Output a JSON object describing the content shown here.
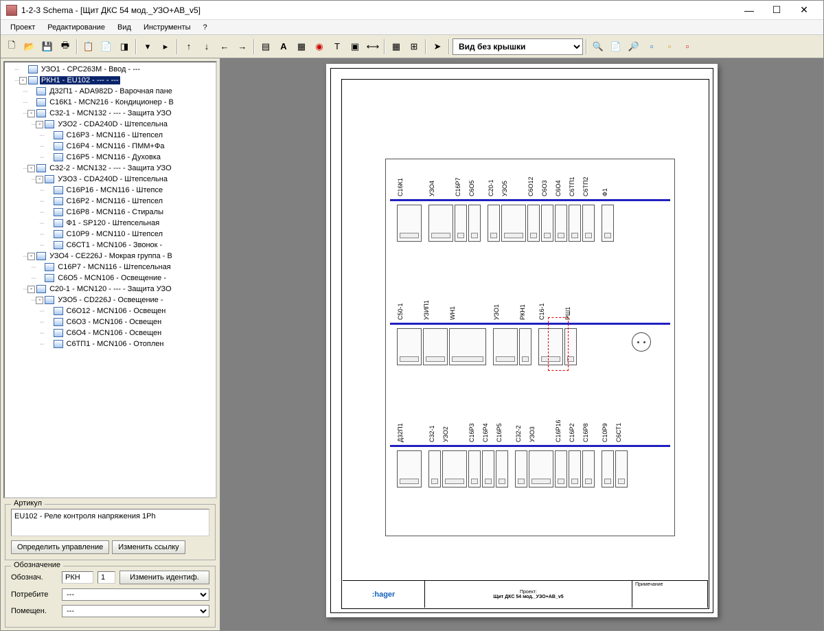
{
  "window": {
    "title": "1-2-3 Schema - [Щит ДКС 54 мод._УЗО+АВ_v5]"
  },
  "menu": {
    "items": [
      "Проект",
      "Редактирование",
      "Вид",
      "Инструменты",
      "?"
    ]
  },
  "toolbar": {
    "view_select": "Вид без крышки"
  },
  "tree": {
    "nodes": [
      {
        "depth": 1,
        "toggle": "",
        "label": "УЗО1 - CPC263M - Ввод - ---"
      },
      {
        "depth": 1,
        "toggle": "-",
        "label": "РКН1 - EU102 - --- - ---",
        "selected": true
      },
      {
        "depth": 2,
        "toggle": "",
        "label": "Д32П1 - ADA982D - Варочная пане"
      },
      {
        "depth": 2,
        "toggle": "",
        "label": "С16К1 - MCN216 - Кондиционер - В"
      },
      {
        "depth": 2,
        "toggle": "-",
        "label": "С32-1 - MCN132 - --- - Защита УЗО"
      },
      {
        "depth": 3,
        "toggle": "-",
        "label": "УЗО2 - CDA240D - Штепсельна"
      },
      {
        "depth": 4,
        "toggle": "",
        "label": "С16Р3 - MCN116 - Штепсел"
      },
      {
        "depth": 4,
        "toggle": "",
        "label": "С16Р4 - MCN116 - ПММ+Фа"
      },
      {
        "depth": 4,
        "toggle": "",
        "label": "С16Р5 - MCN116 - Духовка"
      },
      {
        "depth": 2,
        "toggle": "-",
        "label": "С32-2 - MCN132 - --- - Защита УЗО"
      },
      {
        "depth": 3,
        "toggle": "-",
        "label": "УЗО3 - CDA240D - Штепсельна"
      },
      {
        "depth": 4,
        "toggle": "",
        "label": "С16Р16 - MCN116 - Штепсе"
      },
      {
        "depth": 4,
        "toggle": "",
        "label": "С16Р2 - MCN116 - Штепсел"
      },
      {
        "depth": 4,
        "toggle": "",
        "label": "С16Р8 - MCN116 - Стиралы"
      },
      {
        "depth": 4,
        "toggle": "",
        "label": "Ф1 - SP120 - Штепсельная"
      },
      {
        "depth": 4,
        "toggle": "",
        "label": "С10Р9 - MCN110 - Штепсел"
      },
      {
        "depth": 4,
        "toggle": "",
        "label": "С6СТ1 - MCN106 - Звонок -"
      },
      {
        "depth": 2,
        "toggle": "-",
        "label": "УЗО4 - CE226J - Мокрая группа - В"
      },
      {
        "depth": 3,
        "toggle": "",
        "label": "С16Р7 - MCN116 - Штепсельная"
      },
      {
        "depth": 3,
        "toggle": "",
        "label": "С6О5 - MCN106 - Освещение -"
      },
      {
        "depth": 2,
        "toggle": "-",
        "label": "С20-1 - MCN120 - --- - Защита УЗО"
      },
      {
        "depth": 3,
        "toggle": "-",
        "label": "УЗО5 - CD226J - Освещение -"
      },
      {
        "depth": 4,
        "toggle": "",
        "label": "С6О12 - MCN106 - Освещен"
      },
      {
        "depth": 4,
        "toggle": "",
        "label": "С6О3 - MCN106 - Освещен"
      },
      {
        "depth": 4,
        "toggle": "",
        "label": "С6О4 - MCN106 - Освещен"
      },
      {
        "depth": 4,
        "toggle": "",
        "label": "С6ТП1 - MCN106 - Отоплен"
      }
    ]
  },
  "article": {
    "legend": "Артикул",
    "text": "EU102 - Реле контроля напряжения 1Ph",
    "btn_define": "Определить управление",
    "btn_change_link": "Изменить ссылку"
  },
  "designation": {
    "legend": "Обозначение",
    "label_desig": "Обознач.",
    "prefix": "РКН",
    "number": "1",
    "btn_change_id": "Изменить идентиф.",
    "label_consumer": "Потребите",
    "consumer_value": "---",
    "label_room": "Помещен.",
    "room_value": "---"
  },
  "panel": {
    "row1": [
      "С16К1",
      "",
      "УЗО4",
      "С16Р7",
      "С6О5",
      "",
      "С20-1",
      "УЗО5",
      "С6О12",
      "С6О3",
      "С6О4",
      "С6ТП1",
      "С6ТП2",
      "",
      "Ф1"
    ],
    "row2": [
      "С50-1",
      "УЗИП1",
      "WH1",
      "",
      "УЗО1",
      "РКН1",
      "",
      "С16-1",
      "РШ1"
    ],
    "row3": [
      "Д32П1",
      "",
      "С32-1",
      "УЗО2",
      "С16Р3",
      "С16Р4",
      "С16Р5",
      "",
      "С32-2",
      "УЗО3",
      "С16Р16",
      "С16Р2",
      "С16Р8",
      "",
      "С10Р9",
      "С6СТ1"
    ]
  },
  "title_block": {
    "logo": ":hager",
    "project_label": "Проект:",
    "project_name": "Щит ДКС 54 мод._УЗО+АВ_v5",
    "notes_label": "Примечание"
  }
}
